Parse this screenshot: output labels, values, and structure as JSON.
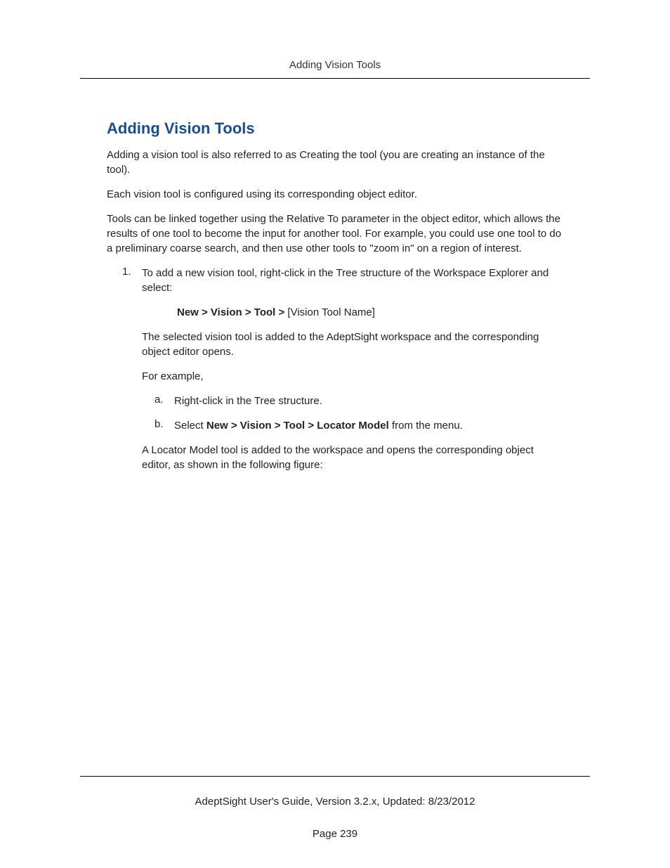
{
  "header": {
    "title": "Adding Vision Tools"
  },
  "section": {
    "title": "Adding Vision Tools",
    "para1": "Adding a vision tool is also referred to as Creating the tool (you are creating an instance of the tool).",
    "para2": "Each vision tool is configured using its corresponding object editor.",
    "para3": "Tools can be linked together using the Relative To parameter in the object editor, which allows the results of one tool to become the input for another tool. For example, you could use one tool to do a preliminary coarse search, and then use other tools to \"zoom in\" on a region of interest."
  },
  "step1": {
    "marker": "1.",
    "text": "To add a new vision tool, right-click in the Tree structure of the Workspace Explorer and select:",
    "menu_bold": "New > Vision > Tool  >",
    "menu_rest": " [Vision Tool Name]",
    "after": "The selected vision tool is added to the AdeptSight workspace and the corresponding object editor opens.",
    "for_example": "For example,"
  },
  "substeps": {
    "a_marker": "a.",
    "a_text": "Right-click in the Tree structure.",
    "b_marker": "b.",
    "b_prefix": "Select  ",
    "b_bold": "New > Vision > Tool > Locator Model",
    "b_suffix": " from the menu."
  },
  "step1_after_sub": "A Locator Model tool is added to the workspace and opens the corresponding object editor, as shown in the following figure:",
  "footer": {
    "guide": "AdeptSight User's Guide,  Version 3.2.x, Updated: 8/23/2012",
    "page": "Page 239"
  }
}
